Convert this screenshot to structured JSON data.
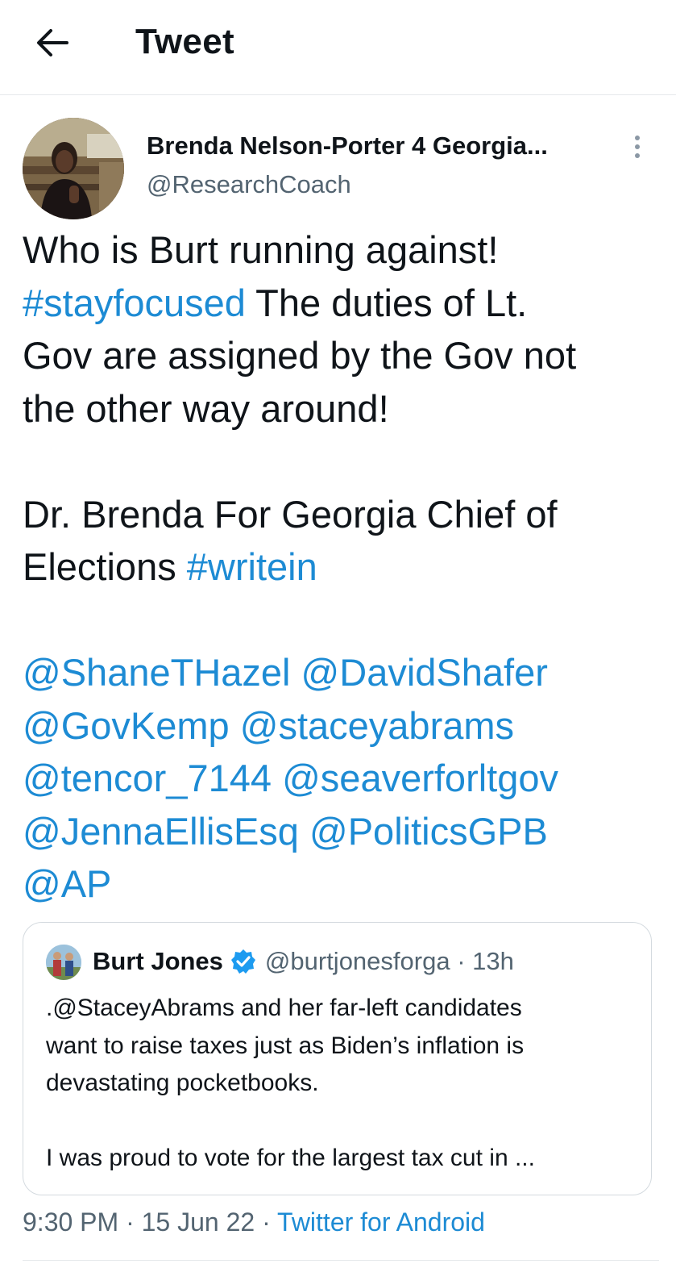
{
  "header": {
    "back_icon": "arrow-left-icon",
    "title": "Tweet"
  },
  "tweet": {
    "author": {
      "display_name": "Brenda Nelson-Porter 4 Georgia...",
      "handle": "@ResearchCoach",
      "avatar_icon": "profile-photo"
    },
    "more_icon": "vertical-ellipsis-icon",
    "body": {
      "line1": "Who is Burt running against!",
      "line2_hashtag": "#stayfocused",
      "line2_text": " The duties of Lt.",
      "line3": "Gov are assigned by the Gov not",
      "line4": "the other way around!",
      "line5": "Dr. Brenda For Georgia Chief of",
      "line6_text": "Elections ",
      "line6_hashtag": "#writein",
      "mentions": [
        "@ShaneTHazel @DavidShafer",
        "@GovKemp @staceyabrams",
        "@tencor_7144 @seaverforltgov",
        "@JennaEllisEsq @PoliticsGPB",
        "@AP"
      ]
    },
    "quoted": {
      "display_name": "Burt Jones",
      "verified_icon": "verified-badge-icon",
      "handle_time": "@burtjonesforga · 13h",
      "lines": [
        ".@StaceyAbrams and her far-left candidates",
        "want to raise taxes just as Biden’s inflation is",
        "devastating  pocketbooks."
      ],
      "line_after_gap": "I was proud to vote for the largest tax cut in ..."
    },
    "meta": {
      "time_date": "9:30 PM · 15 Jun 22 · ",
      "source": "Twitter for Android"
    }
  },
  "colors": {
    "link": "#1d8bd4",
    "secondary_text": "#536471",
    "primary_text": "#0f1419",
    "divider": "#e6e9eb"
  }
}
